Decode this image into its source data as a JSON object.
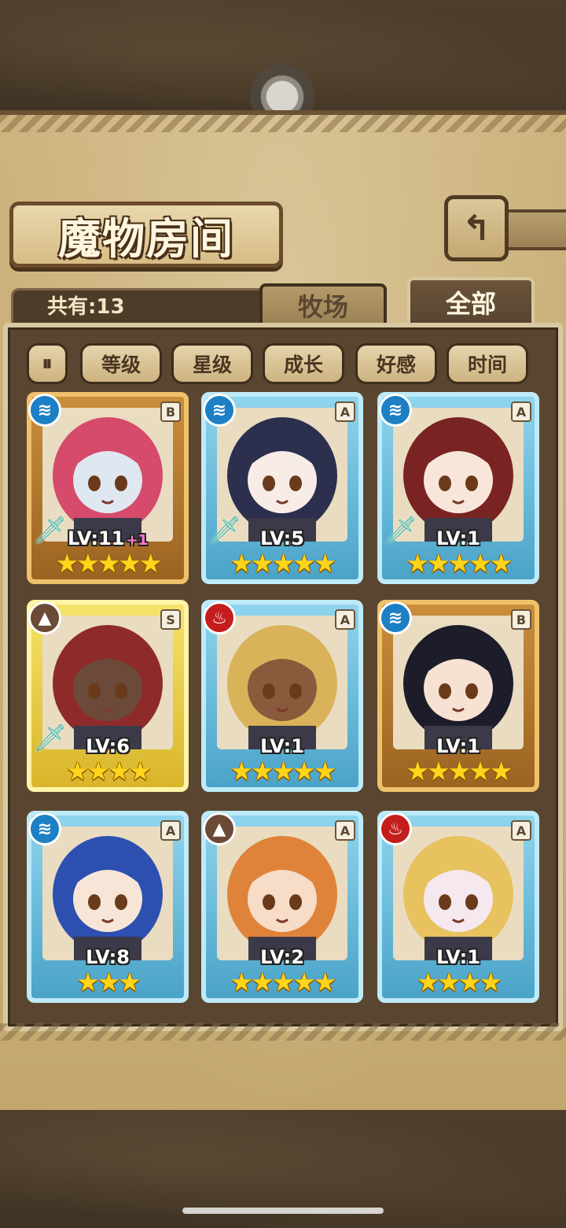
{
  "header": {
    "title": "魔物房间",
    "back_icon": "back-arrow-icon"
  },
  "summary": {
    "count_text": "共有:13"
  },
  "tabs": [
    {
      "label": "牧场",
      "active": false
    },
    {
      "label": "全部",
      "active": true
    }
  ],
  "filters": {
    "sort_toggle": "⏸",
    "buttons": [
      "等级",
      "星级",
      "成长",
      "好感",
      "时间"
    ]
  },
  "monsters": [
    {
      "element": "water",
      "rank": "B",
      "frame": "gold",
      "level": "LV:11",
      "plus": "+1",
      "stars": "★★★★★",
      "weapon": true
    },
    {
      "element": "water",
      "rank": "A",
      "frame": "blue",
      "level": "LV:5",
      "plus": "",
      "stars": "★★★★★",
      "weapon": true
    },
    {
      "element": "water",
      "rank": "A",
      "frame": "blue",
      "level": "LV:1",
      "plus": "",
      "stars": "★★★★★",
      "weapon": true
    },
    {
      "element": "earth",
      "rank": "S",
      "frame": "yellow",
      "level": "LV:6",
      "plus": "",
      "stars": "★★★★",
      "weapon": true
    },
    {
      "element": "fire",
      "rank": "A",
      "frame": "blue",
      "level": "LV:1",
      "plus": "",
      "stars": "★★★★★",
      "weapon": false
    },
    {
      "element": "water",
      "rank": "B",
      "frame": "gold",
      "level": "LV:1",
      "plus": "",
      "stars": "★★★★★",
      "weapon": false
    },
    {
      "element": "water",
      "rank": "A",
      "frame": "blue",
      "level": "LV:8",
      "plus": "",
      "stars": "★★★",
      "weapon": false
    },
    {
      "element": "earth",
      "rank": "A",
      "frame": "blue",
      "level": "LV:2",
      "plus": "",
      "stars": "★★★★★",
      "weapon": false
    },
    {
      "element": "fire",
      "rank": "A",
      "frame": "blue",
      "level": "LV:1",
      "plus": "",
      "stars": "★★★★",
      "weapon": false
    }
  ],
  "colors": {
    "water": "#1d7fc4",
    "fire": "#c41d1d",
    "earth": "#6b4a36",
    "portrait_hair": [
      "#d64a6b",
      "#2c2f4d",
      "#7a2323",
      "#8f2a2a",
      "#d9b25a",
      "#1c1c2a",
      "#2d4fb0",
      "#e0833a",
      "#e7c25f"
    ],
    "portrait_skin": [
      "#dfe7f1",
      "#f7ece6",
      "#f9e6da",
      "#6b4a3a",
      "#8a5a3c",
      "#f7e1d2",
      "#f7e6d8",
      "#f7dcc7",
      "#f5e8ee"
    ]
  }
}
